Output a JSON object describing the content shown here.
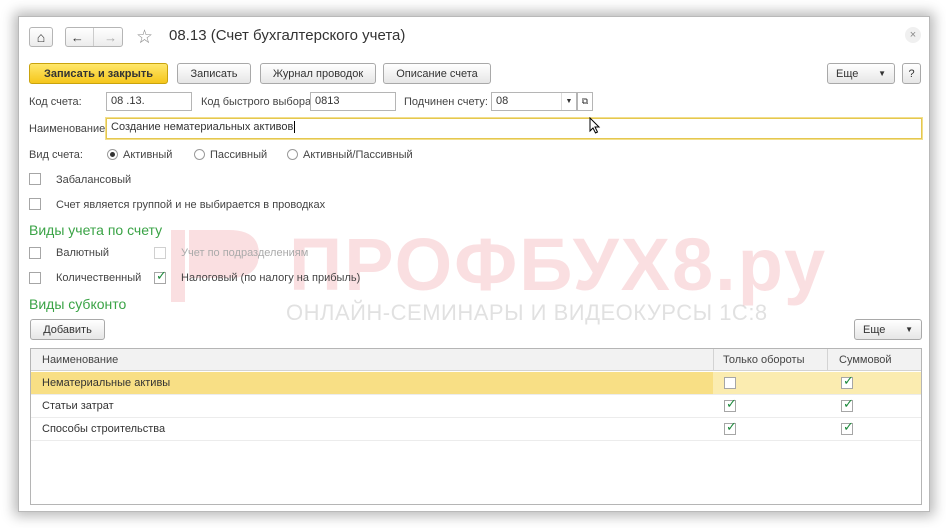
{
  "window": {
    "title": "08.13 (Счет бухгалтерского учета)",
    "close_glyph": "×"
  },
  "nav": {
    "home_glyph": "⌂",
    "back_glyph": "←",
    "forward_glyph": "→",
    "star_glyph": "☆"
  },
  "toolbar": {
    "save_close": "Записать и закрыть",
    "save": "Записать",
    "journal": "Журнал проводок",
    "description": "Описание счета",
    "more": "Еще",
    "help": "?"
  },
  "form": {
    "code_label": "Код счета:",
    "code_value": "08 .13.",
    "quick_label": "Код быстрого выбора:",
    "quick_value": "0813",
    "parent_label": "Подчинен счету:",
    "parent_value": "08",
    "name_label": "Наименование:",
    "name_value": "Создание нематериальных активов",
    "type_label": "Вид счета:",
    "type_options": [
      "Активный",
      "Пассивный",
      "Активный/Пассивный"
    ],
    "type_selected": "Активный",
    "offbalance_label": "Забалансовый",
    "offbalance_checked": false,
    "group_label": "Счет является группой и не выбирается в проводках",
    "group_checked": false
  },
  "accounting": {
    "title": "Виды учета по счету",
    "currency_label": "Валютный",
    "currency_checked": false,
    "quantity_label": "Количественный",
    "quantity_checked": false,
    "division_label": "Учет по подразделениям",
    "division_checked": false,
    "tax_label": "Налоговый (по налогу на прибыль)",
    "tax_checked": true
  },
  "subconto": {
    "title": "Виды субконто",
    "add_label": "Добавить",
    "more_label": "Еще",
    "columns": [
      "Наименование",
      "Только обороты",
      "Суммовой"
    ],
    "rows": [
      {
        "name": "Нематериальные активы",
        "turnover_only": false,
        "sum": true
      },
      {
        "name": "Статьи затрат",
        "turnover_only": true,
        "sum": true
      },
      {
        "name": "Способы строительства",
        "turnover_only": true,
        "sum": true
      }
    ]
  },
  "watermark": {
    "brand": "ПРОФБУХ8.ру",
    "tagline": "ОНЛАЙН-СЕМИНАРЫ И ВИДЕОКУРСЫ 1С:8",
    "color": "#e1505a"
  },
  "colors": {
    "accent_green": "#3aa346",
    "primary_button": "#f5c61b",
    "selected_row": "#fbecb0",
    "check_green": "#1d8a3c"
  }
}
